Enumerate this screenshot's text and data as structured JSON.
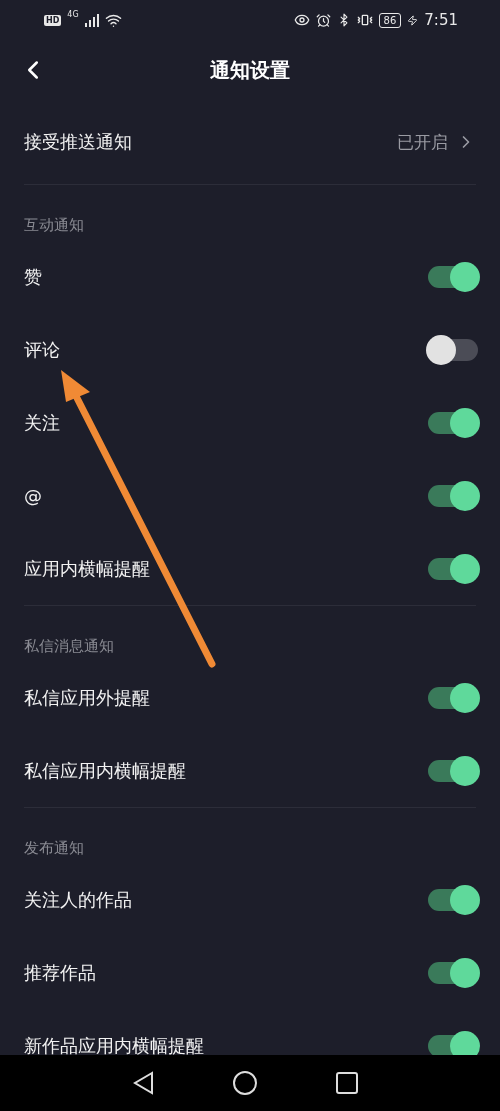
{
  "status_bar": {
    "badge": "HD",
    "network": "4G",
    "battery": "86",
    "time": "7:51"
  },
  "header": {
    "title": "通知设置"
  },
  "push": {
    "label": "接受推送通知",
    "value": "已开启"
  },
  "sections": [
    {
      "title": "互动通知",
      "items": [
        {
          "label": "赞",
          "on": true
        },
        {
          "label": "评论",
          "on": false
        },
        {
          "label": "关注",
          "on": true
        },
        {
          "label": "@",
          "on": true
        },
        {
          "label": "应用内横幅提醒",
          "on": true
        }
      ]
    },
    {
      "title": "私信消息通知",
      "items": [
        {
          "label": "私信应用外提醒",
          "on": true
        },
        {
          "label": "私信应用内横幅提醒",
          "on": true
        }
      ]
    },
    {
      "title": "发布通知",
      "items": [
        {
          "label": "关注人的作品",
          "on": true
        },
        {
          "label": "推荐作品",
          "on": true
        },
        {
          "label": "新作品应用内横幅提醒",
          "on": true
        }
      ]
    }
  ]
}
